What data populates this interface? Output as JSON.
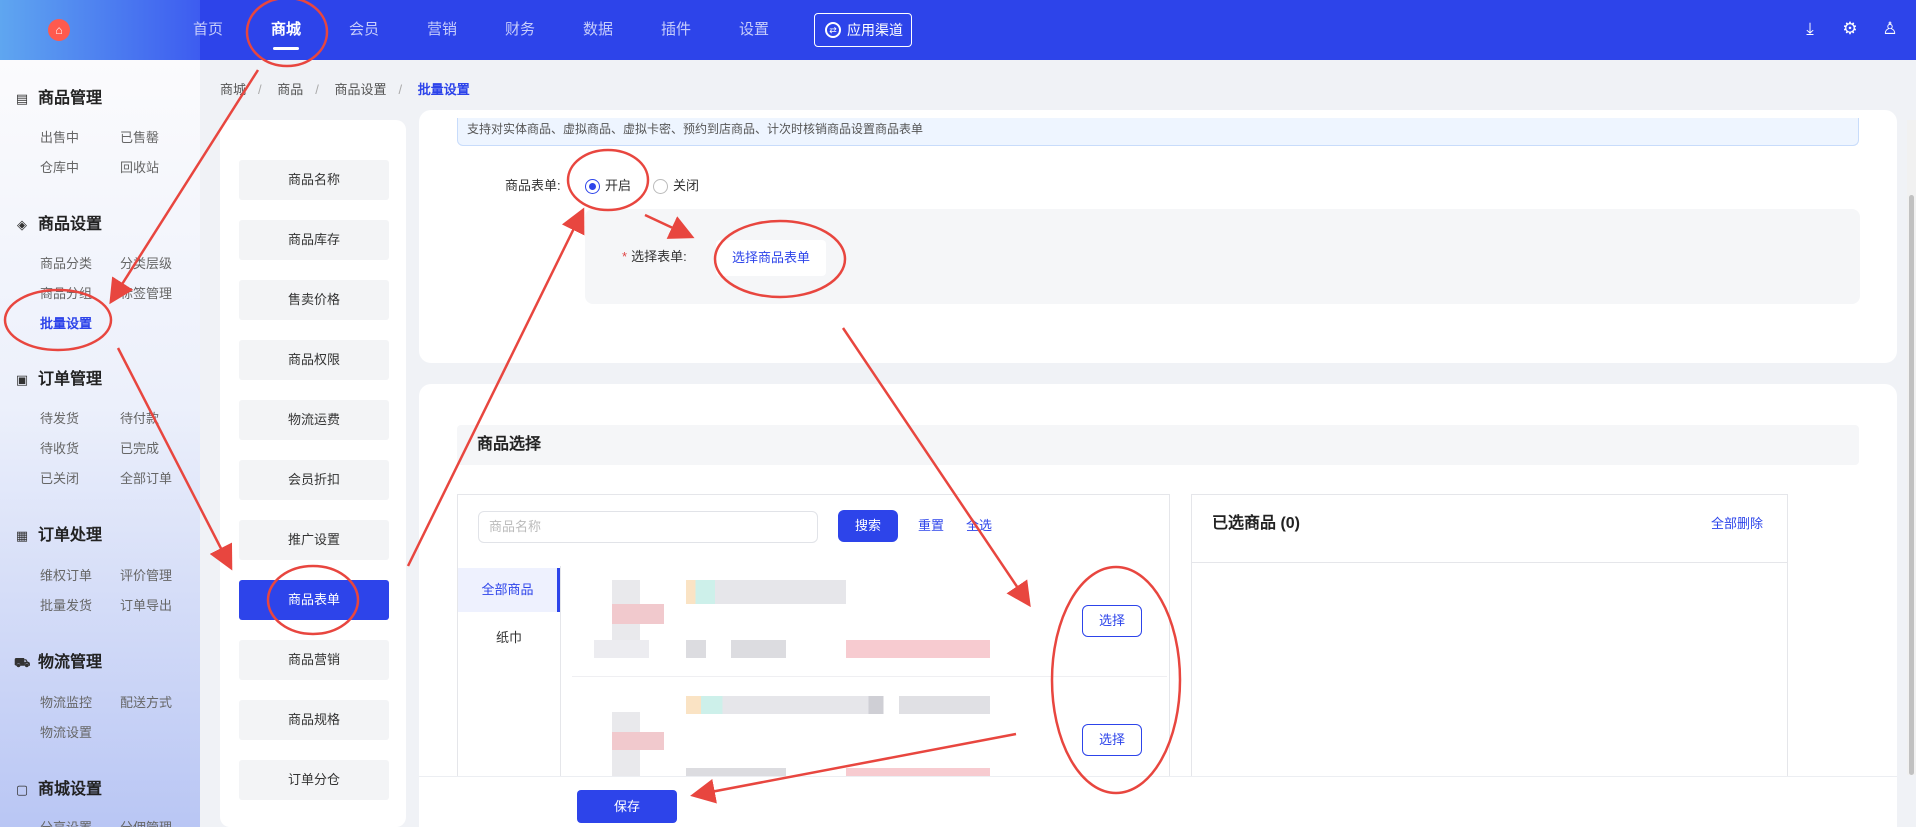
{
  "topbar": {
    "logo_icon": "cart-icon",
    "nav": [
      "首页",
      "商城",
      "会员",
      "营销",
      "财务",
      "数据",
      "插件",
      "设置"
    ],
    "active_nav": "商城",
    "channel_button": "应用渠道",
    "icons": [
      "download-icon",
      "gear-icon",
      "user-icon"
    ]
  },
  "sidebar": {
    "groups": [
      {
        "title": "商品管理",
        "icon": "box-icon",
        "items": [
          "出售中",
          "已售罄",
          "仓库中",
          "回收站"
        ]
      },
      {
        "title": "商品设置",
        "icon": "layers-icon",
        "items": [
          "商品分类",
          "分类层级",
          "商品分组",
          "标签管理",
          "批量设置"
        ]
      },
      {
        "title": "订单管理",
        "icon": "board-icon",
        "items": [
          "待发货",
          "待付款",
          "待收货",
          "已完成",
          "已关闭",
          "全部订单"
        ]
      },
      {
        "title": "订单处理",
        "icon": "document-icon",
        "items": [
          "维权订单",
          "评价管理",
          "批量发货",
          "订单导出"
        ]
      },
      {
        "title": "物流管理",
        "icon": "truck-icon",
        "items": [
          "物流监控",
          "配送方式",
          "物流设置"
        ]
      },
      {
        "title": "商城设置",
        "icon": "shop-icon",
        "items": [
          "分享设置",
          "分佣管理"
        ]
      }
    ],
    "active_item": "批量设置"
  },
  "breadcrumb": [
    "商城",
    "商品",
    "商品设置",
    "批量设置"
  ],
  "setting_menu": {
    "items": [
      "商品名称",
      "商品库存",
      "售卖价格",
      "商品权限",
      "物流运费",
      "会员折扣",
      "推广设置",
      "商品表单",
      "商品营销",
      "商品规格",
      "订单分仓"
    ],
    "active": "商品表单"
  },
  "form": {
    "notice": "支持对实体商品、虚拟商品、虚拟卡密、预约到店商品、计次时核销商品设置商品表单",
    "label": "商品表单:",
    "options": [
      "开启",
      "关闭"
    ],
    "selected": "开启",
    "select_label": "选择表单:",
    "select_link": "选择商品表单"
  },
  "goods_select": {
    "title": "商品选择",
    "search_placeholder": "商品名称",
    "search_button": "搜索",
    "reset_link": "重置",
    "select_all_link": "全选",
    "categories": [
      "全部商品",
      "纸巾"
    ],
    "active_category": "全部商品",
    "row_button": "选择",
    "selected_title": "已选商品 (0)",
    "delete_all": "全部删除"
  },
  "footer": {
    "save": "保存"
  },
  "colors": {
    "primary": "#2d44ea",
    "annotation": "#e8463f"
  }
}
